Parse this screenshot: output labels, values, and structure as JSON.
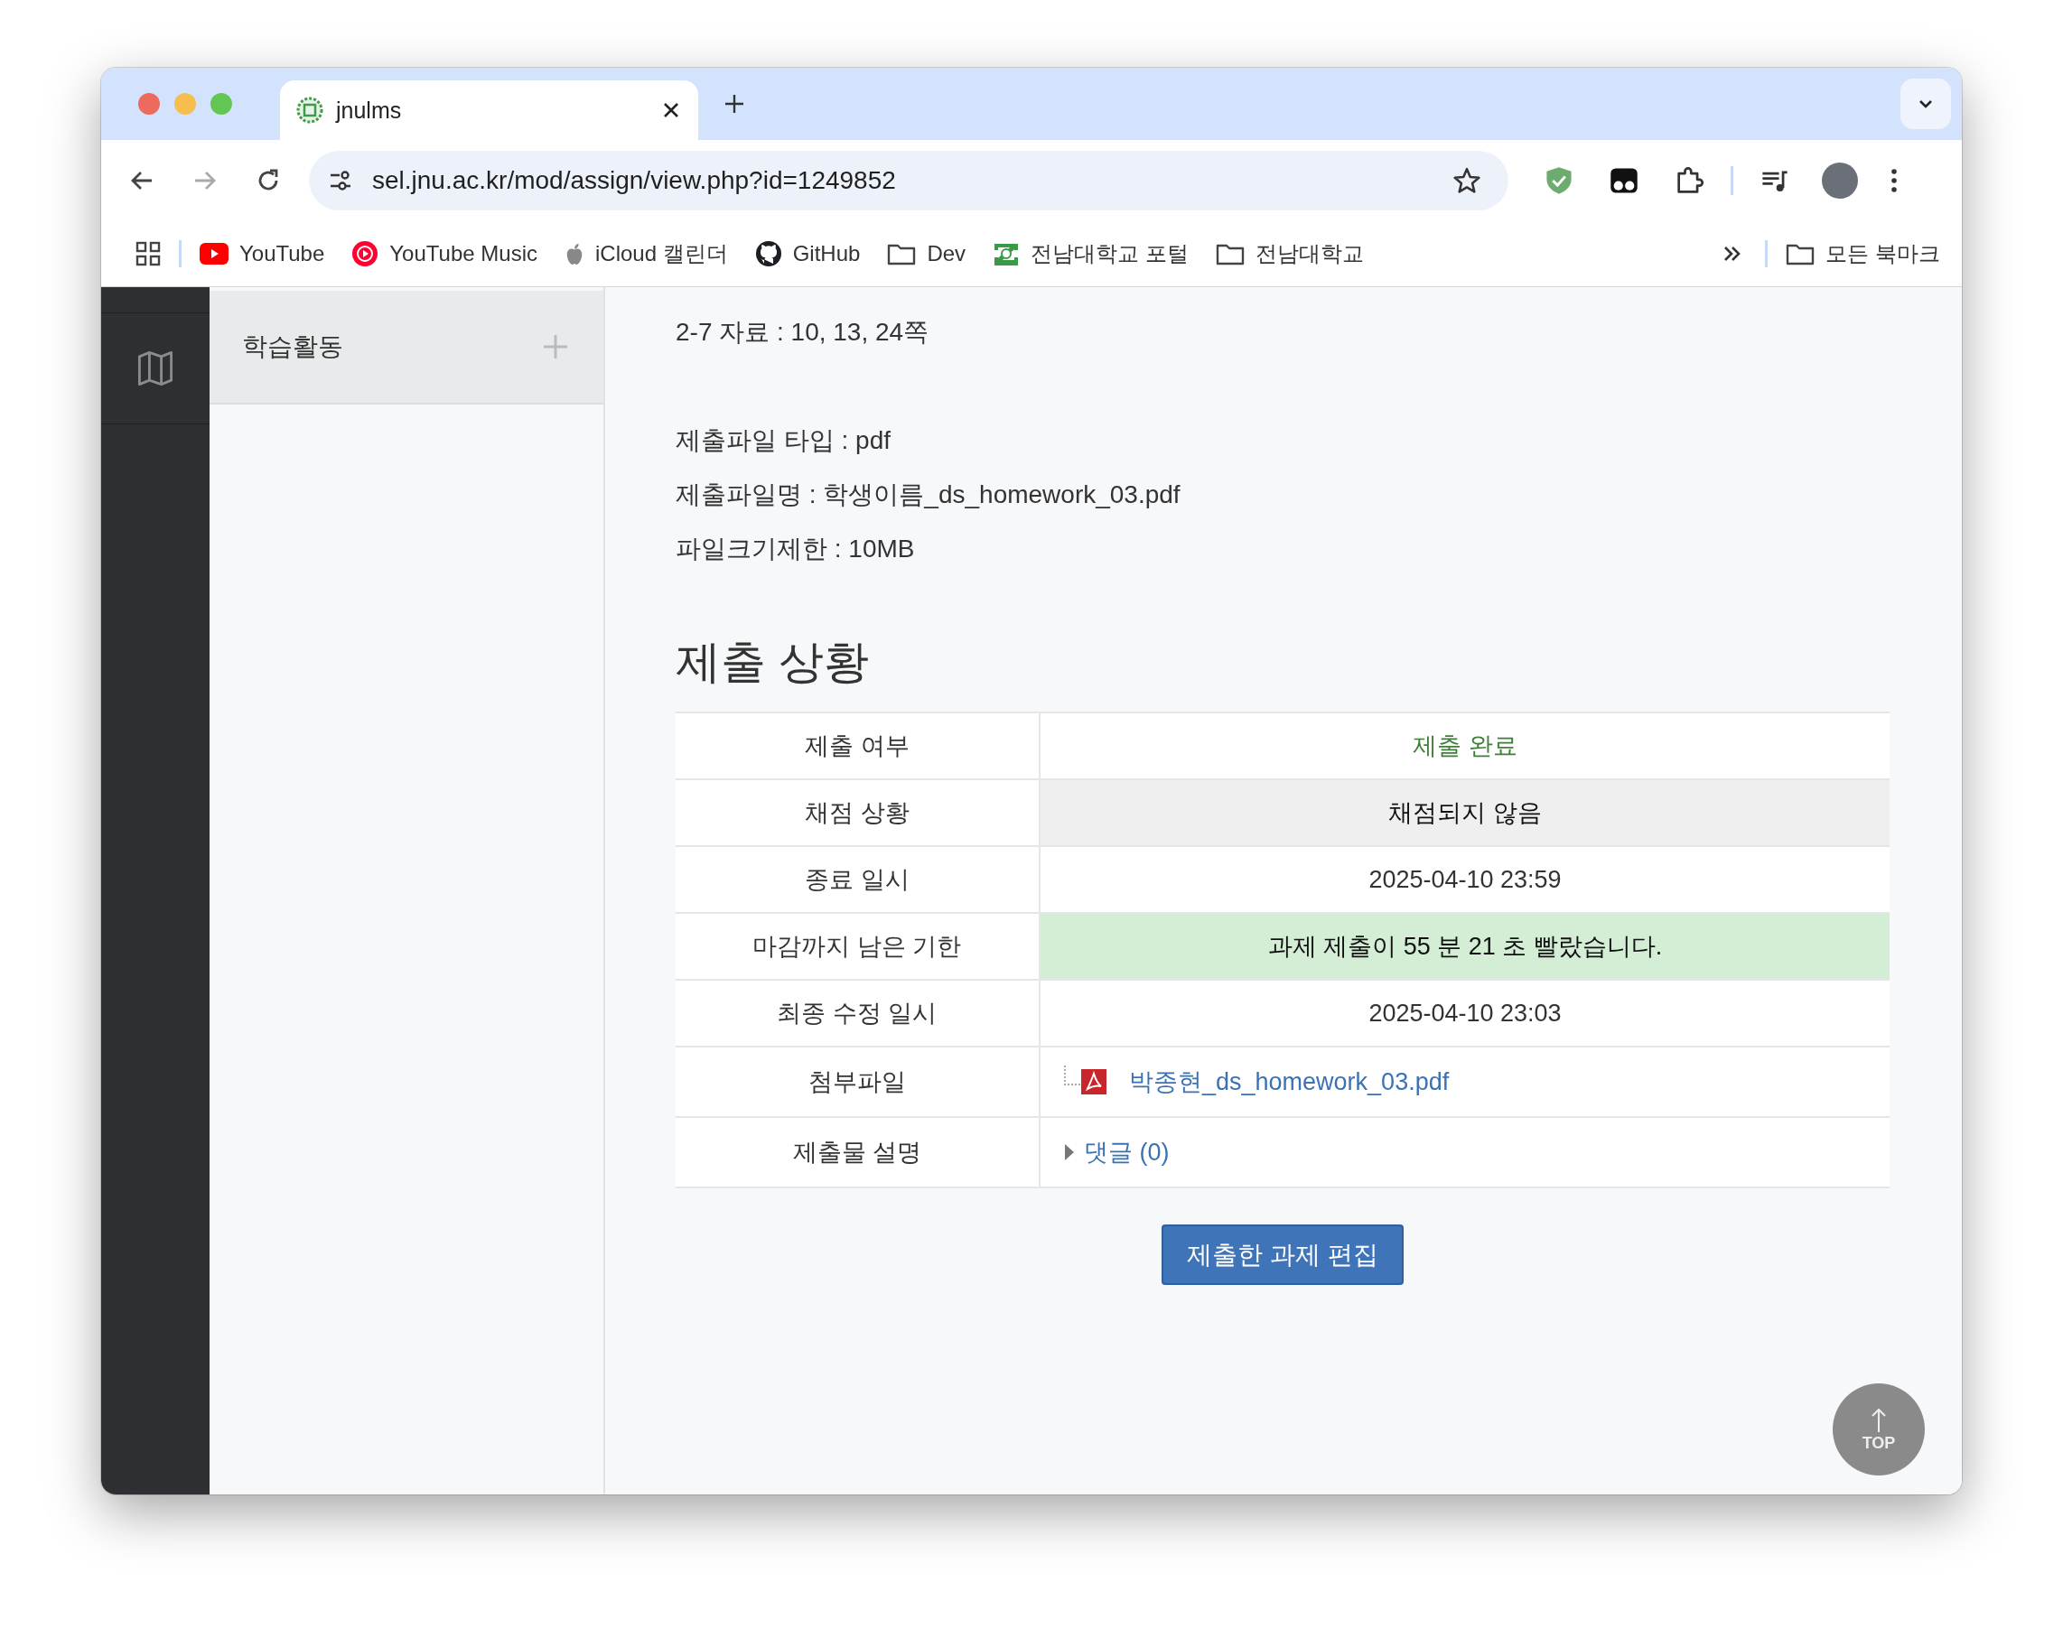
{
  "browser": {
    "tab": {
      "title": "jnulms"
    },
    "address": "sel.jnu.ac.kr/mod/assign/view.php?id=1249852",
    "bookmarks": [
      {
        "label": "YouTube",
        "kind": "youtube"
      },
      {
        "label": "YouTube Music",
        "kind": "music"
      },
      {
        "label": "iCloud 캘린더",
        "kind": "apple"
      },
      {
        "label": "GitHub",
        "kind": "github"
      },
      {
        "label": "Dev",
        "kind": "folder"
      },
      {
        "label": "전남대학교 포털",
        "kind": "school"
      },
      {
        "label": "전남대학교",
        "kind": "folder"
      }
    ],
    "all_bookmarks": "모든 북마크"
  },
  "sidebar": {
    "items": [
      {
        "label": "학습활동"
      }
    ]
  },
  "content": {
    "paragraphs": [
      [
        "2-7 자료 :  10, 13, 24쪽"
      ],
      [
        "제출파일 타입 : pdf",
        "제출파일명 : 학생이름_ds_homework_03.pdf",
        "파일크기제한 : 10MB"
      ]
    ],
    "heading": "제출 상황",
    "table": {
      "rows": [
        {
          "label": "제출 여부",
          "value": "제출 완료",
          "kind": "submitted"
        },
        {
          "label": "채점 상황",
          "value": "채점되지 않음",
          "kind": "grading"
        },
        {
          "label": "종료 일시",
          "value": "2025-04-10 23:59",
          "kind": "plain"
        },
        {
          "label": "마감까지 남은 기한",
          "value": "과제 제출이 55 분 21 초 빨랐습니다.",
          "kind": "early"
        },
        {
          "label": "최종 수정 일시",
          "value": "2025-04-10 23:03",
          "kind": "plain"
        },
        {
          "label": "첨부파일",
          "value": "박종현_ds_homework_03.pdf",
          "kind": "file"
        },
        {
          "label": "제출물 설명",
          "value": "댓글 (0)",
          "kind": "comments"
        }
      ]
    },
    "edit_button": "제출한 과제 편집"
  },
  "top_button": "TOP"
}
